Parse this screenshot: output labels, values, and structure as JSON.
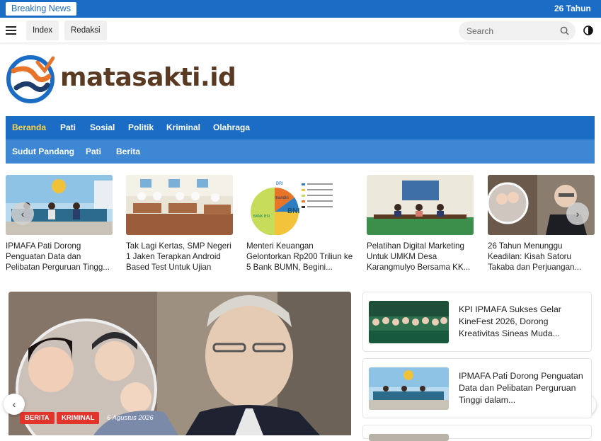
{
  "breaking": {
    "label": "Breaking News",
    "ticker": "26 Tahun"
  },
  "topnav": {
    "links": [
      "Index",
      "Redaksi"
    ],
    "search_placeholder": "Search"
  },
  "brand": {
    "name": "matasakti.id"
  },
  "main_nav": [
    "Beranda",
    "Pati",
    "Sosial",
    "Politik",
    "Kriminal",
    "Olahraga"
  ],
  "sub_nav": [
    "Sudut Pandang",
    "Pati",
    "Berita"
  ],
  "carousel": [
    {
      "title": "IPMAFA Pati Dorong Penguatan Data dan Pelibatan Perguruan Tingg..."
    },
    {
      "title": "Tak Lagi Kertas, SMP Negeri 1 Jaken Terapkan Android Based Test Untuk Ujian"
    },
    {
      "title": "Menteri Keuangan Gelontorkan Rp200 Triliun ke 5 Bank BUMN, Begini..."
    },
    {
      "title": "Pelatihan Digital Marketing Untuk UMKM Desa Karangmulyo Bersama KK..."
    },
    {
      "title": "26 Tahun Menunggu Keadilan: Kisah Satoru Takaba dan Perjuangan..."
    }
  ],
  "carousel_prev": "‹",
  "carousel_next": "›",
  "hero": {
    "tags": [
      "BERITA",
      "KRIMINAL"
    ],
    "date": "6 Agustus 2026",
    "prev": "‹",
    "next": "›"
  },
  "side_list": [
    {
      "title": "KPI IPMAFA Sukses Gelar KineFest 2026, Dorong Kreativitas Sineas Muda..."
    },
    {
      "title": "IPMAFA Pati Dorong Penguatan Data dan Pelibatan Perguruan Tinggi dalam..."
    }
  ],
  "pie_labels": [
    "BRI",
    "mandiri",
    "BNI",
    "BANK BSI"
  ],
  "colors": {
    "primary": "#1a6cc4",
    "secondary": "#3d87d4",
    "active": "#ffd24a",
    "badge": "#e2342b",
    "brand_text": "#5a3a22"
  }
}
